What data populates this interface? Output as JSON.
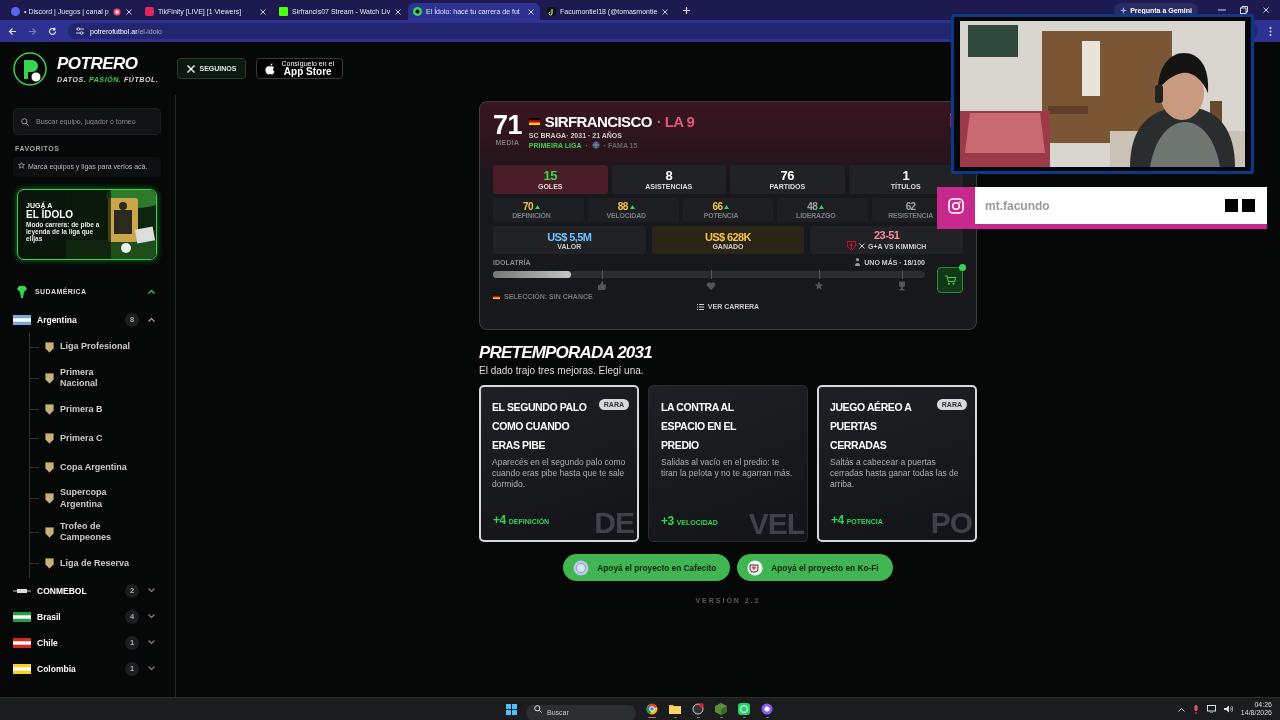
{
  "browser": {
    "tabs": [
      {
        "title": "• Discord | Juegos | canal p",
        "kind": "discord",
        "recording": true,
        "selected": false
      },
      {
        "title": "TikFinity [LIVE] [1 Viewers]",
        "kind": "tikfinity",
        "recording": false,
        "selected": false
      },
      {
        "title": "Sirfrancis07 Stream - Watch Liv",
        "kind": "kick",
        "recording": false,
        "selected": false
      },
      {
        "title": "El Ídolo: hacé tu carrera de fut",
        "kind": "potrero",
        "recording": false,
        "selected": true
      },
      {
        "title": "Facumontiel18 (@tomasmontie",
        "kind": "tiktok",
        "recording": false,
        "selected": false
      }
    ],
    "url_host": "potrerofutbol.ar",
    "url_path": "/el-idolo",
    "gemini_button": "Pregunta a Gemini"
  },
  "header": {
    "logo_name": "POTRERO",
    "logo_tagline": "DATOS. **PASIÓN.** FÚTBOL.",
    "follow_button": "SEGUINOS",
    "app_store_small": "Consíguelo en el",
    "app_store_name": "App Store"
  },
  "sidebar": {
    "search_placeholder": "Buscar equipo, jugador o torneo",
    "favorites_title": "FAVORITOS",
    "favorites_hint": "Marcá equipos y ligas para verlos acá.",
    "promo": {
      "kicker": "JUGÁ A",
      "title": "EL ÍDOLO",
      "text": "Modo carrera: de pibe a leyenda de la liga que elijas"
    },
    "regions": [
      {
        "name": "SUDAMÉRICA",
        "expanded": true,
        "children": [
          {
            "name": "Argentina",
            "kind": "flag",
            "color": "#75aadb",
            "count": "8",
            "expanded": true,
            "children": [
              {
                "name": "Liga Profesional"
              },
              {
                "name": "Primera Nacional"
              },
              {
                "name": "Primera B"
              },
              {
                "name": "Primera C"
              },
              {
                "name": "Copa Argentina"
              },
              {
                "name": "Supercopa Argentina"
              },
              {
                "name": "Trofeo de Campeones"
              },
              {
                "name": "Liga de Reserva"
              }
            ]
          },
          {
            "name": "CONMEBOL",
            "kind": "logo",
            "count": "2",
            "expanded": false
          },
          {
            "name": "Brasil",
            "kind": "flag",
            "color": "#229e45",
            "count": "4",
            "expanded": false
          },
          {
            "name": "Chile",
            "kind": "flag",
            "color": "#d52b1e",
            "count": "1",
            "expanded": false
          },
          {
            "name": "Colombia",
            "kind": "flag",
            "color": "#fcd116",
            "count": "1",
            "expanded": false
          }
        ]
      }
    ]
  },
  "player": {
    "rating": "71",
    "rating_label": "MEDIA",
    "name": "SIRFRANCISCO",
    "role": "· LA 9",
    "details": "SC BRAGA· 2031 · 21 AÑOS",
    "league": "PRIMEIRA LIGA",
    "separator": "·",
    "fame": "· FAMA 15",
    "stats": [
      {
        "value": "15",
        "label": "GOLES",
        "highlighted": true
      },
      {
        "value": "8",
        "label": "ASISTENCIAS",
        "highlighted": false
      },
      {
        "value": "76",
        "label": "PARTIDOS",
        "highlighted": false
      },
      {
        "value": "1",
        "label": "TÍTULOS",
        "highlighted": false
      }
    ],
    "attributes": [
      {
        "value": "70",
        "label": "DEFINICIÓN",
        "color": "#f5c542",
        "improving": true
      },
      {
        "value": "88",
        "label": "VELOCIDAD",
        "color": "#f5c542",
        "improving": true
      },
      {
        "value": "66",
        "label": "POTENCIA",
        "color": "#f5c542",
        "improving": true
      },
      {
        "value": "48",
        "label": "LIDERAZGO",
        "color": "#9aa0a6",
        "improving": true
      },
      {
        "value": "62",
        "label": "RESISTENCIA",
        "color": "#9aa0a6",
        "improving": false
      }
    ],
    "finances": [
      {
        "value": "US$ 5,5M",
        "label": "VALOR",
        "kind": "value"
      },
      {
        "value": "US$ 628K",
        "label": "GANADO",
        "kind": "earned"
      },
      {
        "value": "23-51",
        "label": "G+A VS KIMMICH",
        "kind": "rival"
      }
    ],
    "idolatry": {
      "label": "IDOLATRÍA",
      "next_level": "UNO MÁS · 18/100",
      "level": 0.18,
      "milestones": [
        {
          "kind": "thumb"
        },
        {
          "kind": "heart"
        },
        {
          "kind": "star"
        },
        {
          "kind": "trophy"
        }
      ]
    },
    "national_team": "SELECCIÓN: SIN CHANCE",
    "career_button": "VER CARRERA",
    "shop_notification": true
  },
  "preseason": {
    "title": "PRETEMPORADA 2031",
    "subtitle": "El dado trajo tres mejoras. Elegí una.",
    "upgrades": [
      {
        "title": "EL SEGUNDO PALO COMO CUANDO ERAS PIBE",
        "rarity": "RARA",
        "description": "Aparecés en el segundo palo como cuando eras pibe hasta que te sale dormido.",
        "bonus": "+4",
        "attribute": "DEFINICIÓN",
        "watermark": "DE"
      },
      {
        "title": "LA CONTRA AL ESPACIO EN EL PREDIO",
        "description": "Salidas al vacío en el predio: te tiran la pelota y no te agarran más.",
        "bonus": "+3",
        "attribute": "VELOCIDAD",
        "watermark": "VEL"
      },
      {
        "title": "JUEGO AÉREO A PUERTAS CERRADAS",
        "rarity": "RARA",
        "description": "Saltás a cabecear a puertas cerradas hasta ganar todas las de arriba.",
        "bonus": "+4",
        "attribute": "POTENCIA",
        "watermark": "PO"
      }
    ]
  },
  "support_buttons": [
    {
      "label": "Apoyá el proyecto en Cafecito",
      "kind": "cafecito"
    },
    {
      "label": "Apoyá el proyecto en Ko-Fi",
      "kind": "kofi"
    }
  ],
  "version": "VERSIÓN 2.2",
  "overlay": {
    "instagram_handle": "mt.facundo"
  },
  "taskbar": {
    "search_placeholder": "Buscar",
    "time": "04:26",
    "date": "14/8/2026",
    "apps": [
      {
        "kind": "browser",
        "active": true
      },
      {
        "kind": "folder",
        "active": false
      },
      {
        "kind": "gamepad",
        "active": false
      },
      {
        "kind": "cube",
        "active": false
      },
      {
        "kind": "phone",
        "active": false
      },
      {
        "kind": "bubble",
        "active": false
      }
    ]
  }
}
